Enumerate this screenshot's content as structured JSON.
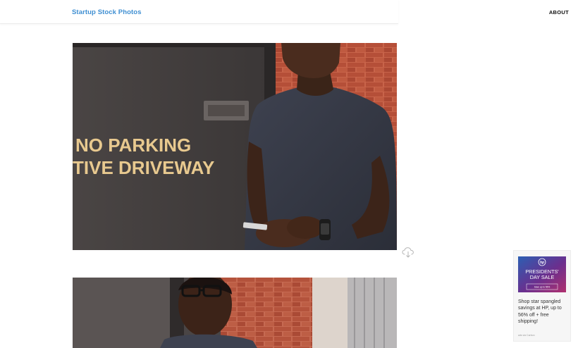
{
  "header": {
    "brand": "Startup Stock Photos",
    "nav_about": "ABOUT"
  },
  "photos": [
    {
      "sign_line_1": "NO PARKING",
      "sign_line_2": "TIVE DRIVEWAY"
    },
    {}
  ],
  "download": {
    "icon": "cloud-download-icon"
  },
  "ad": {
    "brand_logo": "hp",
    "headline_1": "PRESIDENTS'",
    "headline_2": "DAY SALE",
    "cta": "Save up to 56%",
    "text": "Shop star spangled savings at HP, up to 56% off + free shipping!",
    "via": "ads via Carbon"
  },
  "colors": {
    "brand": "#3f8fd2",
    "ad_background": "#6a2f8e"
  }
}
